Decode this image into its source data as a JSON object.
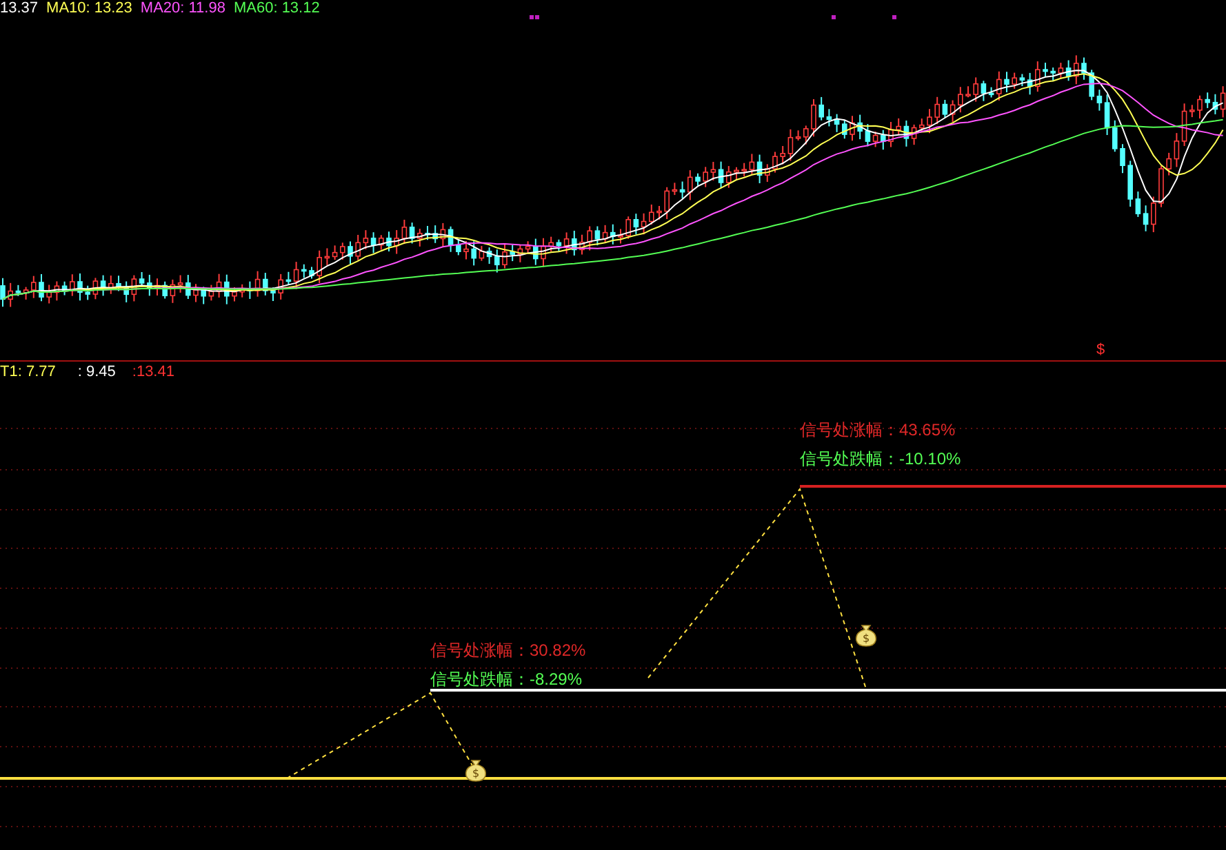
{
  "top_pane": {
    "legend": [
      {
        "label": "13.37",
        "color": "#ffffff"
      },
      {
        "label": "MA10: 13.23",
        "color": "#ffff54"
      },
      {
        "label": "MA20: 11.98",
        "color": "#ff54ff"
      },
      {
        "label": "MA60: 13.12",
        "color": "#54ff54"
      }
    ],
    "marker": "$"
  },
  "bottom_pane": {
    "legend": [
      {
        "label": "T1: 7.77",
        "color": "#ffff54"
      },
      {
        "label": ": 9.45",
        "color": "#ffffff"
      },
      {
        "label": ":13.41",
        "color": "#ff3232"
      }
    ],
    "signals": [
      {
        "rise_label": "信号处涨幅：30.82%",
        "fall_label": "信号处跌幅：-8.29%"
      },
      {
        "rise_label": "信号处涨幅：43.65%",
        "fall_label": "信号处跌幅：-10.10%"
      }
    ]
  }
}
